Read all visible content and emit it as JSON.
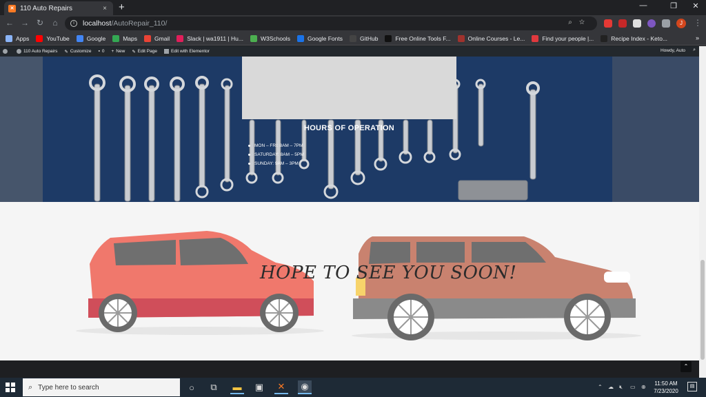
{
  "browser": {
    "tab_title": "110 Auto Repairs",
    "new_tab_symbol": "+",
    "tab_close_symbol": "×",
    "url_host": "localhost",
    "url_path": "/AutoRepair_110/",
    "profile_initial": "J",
    "window_controls": [
      "—",
      "❐",
      "✕"
    ],
    "bookmarks": [
      {
        "label": "Apps",
        "color": "#8ab4f8"
      },
      {
        "label": "YouTube",
        "color": "#ff0000"
      },
      {
        "label": "Google",
        "color": "#4285f4"
      },
      {
        "label": "Maps",
        "color": "#34a853"
      },
      {
        "label": "Gmail",
        "color": "#ea4335"
      },
      {
        "label": "Slack | wa1911 | Hu...",
        "color": "#e01e5a"
      },
      {
        "label": "W3Schools",
        "color": "#4caf50"
      },
      {
        "label": "Google Fonts",
        "color": "#1a73e8"
      },
      {
        "label": "GitHub",
        "color": "#444444"
      },
      {
        "label": "Free Online Tools F...",
        "color": "#111111"
      },
      {
        "label": "Online Courses - Le...",
        "color": "#a0322d"
      },
      {
        "label": "Find your people |...",
        "color": "#e0393e"
      },
      {
        "label": "Recipe Index - Keto...",
        "color": "#222222"
      }
    ],
    "bookmarks_more": "»"
  },
  "wp_admin": {
    "items": [
      "110 Auto Repairs",
      "Customize",
      "0",
      "New",
      "Edit Page",
      "Edit with Elementor"
    ],
    "howdy": "Howdy, Auto"
  },
  "hero": {
    "hours_title": "HOURS OF OPERATION",
    "hours": [
      "MON – FRI:   8AM – 7PM",
      "SATURDAY:   8AM – 5PM",
      "SUNDAY:   9AM – 3PM"
    ]
  },
  "cars_section": {
    "tagline": "HOPE TO SEE YOU SOON!"
  },
  "back_to_top_symbol": "⌃",
  "taskbar": {
    "search_placeholder": "Type here to search",
    "time": "11:50 AM",
    "date": "7/23/2020"
  }
}
